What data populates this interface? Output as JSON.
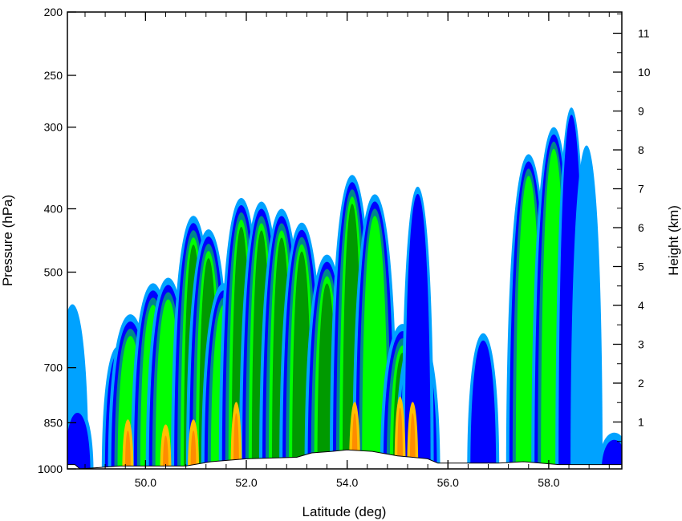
{
  "chart_data": {
    "type": "contour-cross-section",
    "xlabel": "Latitude (deg)",
    "ylabel_left": "Pressure (hPa)",
    "ylabel_right": "Height (km)",
    "xlim": [
      48.45,
      59.45
    ],
    "x_ticks": [
      50.0,
      52.0,
      54.0,
      56.0,
      58.0
    ],
    "x_tick_labels": [
      "50.0",
      "52.0",
      "54.0",
      "56.0",
      "58.0"
    ],
    "x_minor_step": 0.4,
    "y_left_scale": "log",
    "y_left_lim": [
      1000,
      200
    ],
    "y_left_ticks": [
      1000,
      850,
      700,
      500,
      400,
      300,
      250,
      200
    ],
    "y_left_tick_labels": [
      "1000",
      "850",
      "700",
      "500",
      "400",
      "300",
      "250",
      "200"
    ],
    "y_right_ticks": [
      1,
      2,
      3,
      4,
      5,
      6,
      7,
      8,
      9,
      10,
      11
    ],
    "y_right_tick_labels": [
      "1",
      "2",
      "3",
      "4",
      "5",
      "6",
      "7",
      "8",
      "9",
      "10",
      "11"
    ],
    "fill_colors": [
      "#00a2ff",
      "#0000ff",
      "#00878c",
      "#00ff00",
      "#009a00",
      "#ffc000",
      "#ff8c00"
    ],
    "columns": [
      {
        "lat": 48.55,
        "top": 560,
        "level": 0
      },
      {
        "lat": 48.65,
        "top": 800,
        "level": 1
      },
      {
        "lat": 49.45,
        "top": 650,
        "level": 2
      },
      {
        "lat": 49.7,
        "top": 580,
        "level": 3
      },
      {
        "lat": 50.15,
        "top": 520,
        "level": 3
      },
      {
        "lat": 50.45,
        "top": 510,
        "level": 3
      },
      {
        "lat": 50.95,
        "top": 410,
        "level": 4
      },
      {
        "lat": 51.25,
        "top": 430,
        "level": 4
      },
      {
        "lat": 51.55,
        "top": 520,
        "level": 3
      },
      {
        "lat": 51.9,
        "top": 385,
        "level": 4
      },
      {
        "lat": 52.3,
        "top": 390,
        "level": 4
      },
      {
        "lat": 52.7,
        "top": 400,
        "level": 4
      },
      {
        "lat": 53.1,
        "top": 420,
        "level": 4
      },
      {
        "lat": 53.6,
        "top": 470,
        "level": 4
      },
      {
        "lat": 54.1,
        "top": 355,
        "level": 4
      },
      {
        "lat": 54.55,
        "top": 380,
        "level": 3
      },
      {
        "lat": 55.1,
        "top": 600,
        "level": 4
      },
      {
        "lat": 55.4,
        "top": 610,
        "level": 4
      },
      {
        "lat": 55.4,
        "top": 370,
        "level": 1
      },
      {
        "lat": 56.7,
        "top": 620,
        "level": 1
      },
      {
        "lat": 57.6,
        "top": 330,
        "level": 3
      },
      {
        "lat": 58.1,
        "top": 300,
        "level": 3
      },
      {
        "lat": 58.45,
        "top": 280,
        "level": 1
      },
      {
        "lat": 58.75,
        "top": 320,
        "level": 0
      },
      {
        "lat": 59.3,
        "top": 880,
        "level": 1
      }
    ],
    "yellow_cores": [
      {
        "lat": 49.65,
        "top": 840
      },
      {
        "lat": 50.4,
        "top": 855
      },
      {
        "lat": 50.95,
        "top": 840
      },
      {
        "lat": 51.8,
        "top": 790
      },
      {
        "lat": 54.15,
        "top": 790
      },
      {
        "lat": 55.05,
        "top": 775
      },
      {
        "lat": 55.3,
        "top": 790
      }
    ],
    "terrain_pressure": [
      {
        "lat": 48.45,
        "p": 985
      },
      {
        "lat": 48.6,
        "p": 985
      },
      {
        "lat": 48.7,
        "p": 1000
      },
      {
        "lat": 49.5,
        "p": 990
      },
      {
        "lat": 50.8,
        "p": 990
      },
      {
        "lat": 51.3,
        "p": 975
      },
      {
        "lat": 52.0,
        "p": 965
      },
      {
        "lat": 53.0,
        "p": 960
      },
      {
        "lat": 53.3,
        "p": 945
      },
      {
        "lat": 53.7,
        "p": 940
      },
      {
        "lat": 54.0,
        "p": 935
      },
      {
        "lat": 54.5,
        "p": 940
      },
      {
        "lat": 55.0,
        "p": 955
      },
      {
        "lat": 55.6,
        "p": 965
      },
      {
        "lat": 55.8,
        "p": 980
      },
      {
        "lat": 57.0,
        "p": 980
      },
      {
        "lat": 57.5,
        "p": 975
      },
      {
        "lat": 58.2,
        "p": 985
      },
      {
        "lat": 59.45,
        "p": 985
      }
    ]
  }
}
